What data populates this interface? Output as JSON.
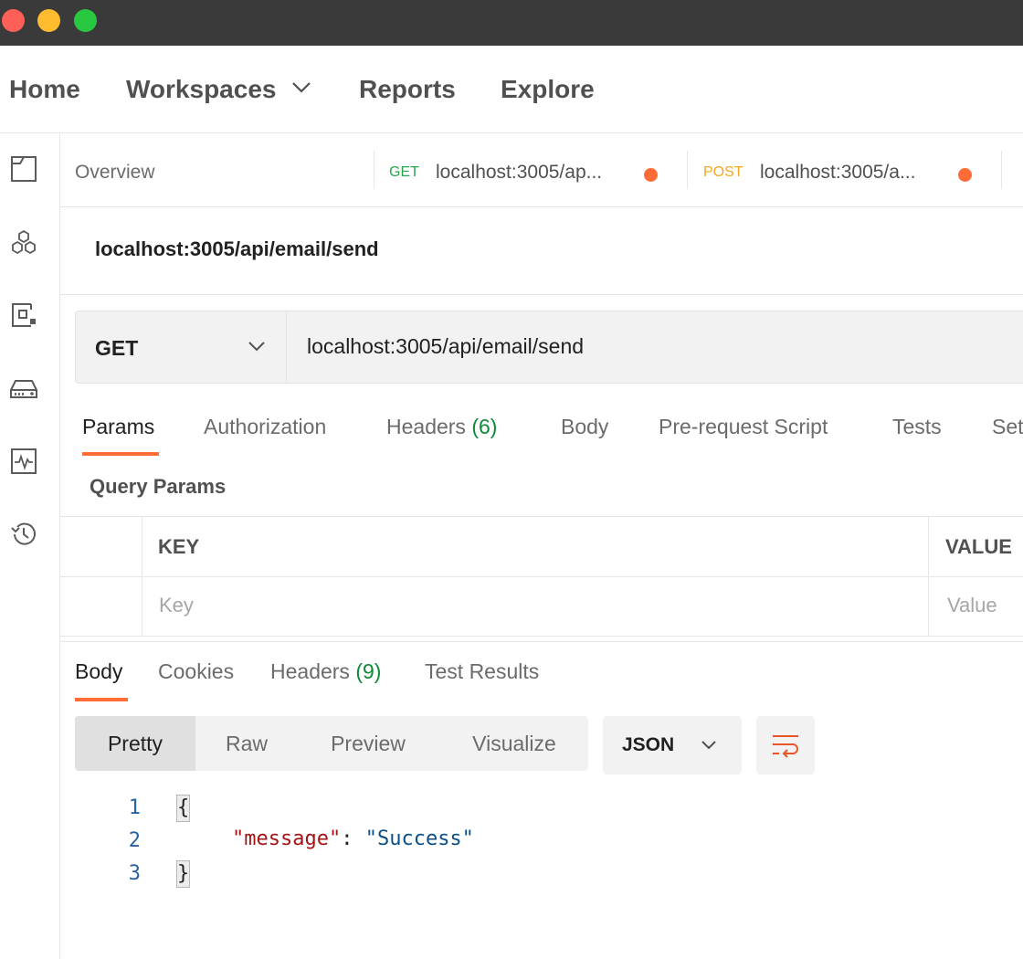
{
  "nav": {
    "home": "Home",
    "workspaces": "Workspaces",
    "reports": "Reports",
    "explore": "Explore"
  },
  "sidebar": {
    "icons": [
      "collections-icon",
      "apis-icon",
      "environments-icon",
      "mock-servers-icon",
      "monitors-icon",
      "history-icon"
    ]
  },
  "tabs": {
    "overview": "Overview",
    "items": [
      {
        "method": "GET",
        "url": "localhost:3005/ap...",
        "method_color": "#2aa44f"
      },
      {
        "method": "POST",
        "url": "localhost:3005/a...",
        "method_color": "#f5a623"
      }
    ],
    "unsaved_dot_color": "#ff6c37"
  },
  "request": {
    "title": "localhost:3005/api/email/send",
    "method": "GET",
    "url": "localhost:3005/api/email/send"
  },
  "request_tabs": {
    "params": "Params",
    "authorization": "Authorization",
    "headers": "Headers",
    "headers_count": "(6)",
    "body": "Body",
    "pre_request": "Pre-request Script",
    "tests": "Tests",
    "settings": "Set"
  },
  "query_params": {
    "label": "Query Params",
    "columns": {
      "key": "KEY",
      "value": "VALUE"
    },
    "placeholders": {
      "key": "Key",
      "value": "Value"
    }
  },
  "response_tabs": {
    "body": "Body",
    "cookies": "Cookies",
    "headers": "Headers",
    "headers_count": "(9)",
    "test_results": "Test Results"
  },
  "response_view": {
    "pretty": "Pretty",
    "raw": "Raw",
    "preview": "Preview",
    "visualize": "Visualize",
    "format": "JSON"
  },
  "response_body": {
    "line_numbers": [
      "1",
      "2",
      "3"
    ],
    "open_brace": "{",
    "key": "\"message\"",
    "colon": ": ",
    "value": "\"Success\"",
    "close_brace": "}"
  },
  "colors": {
    "accent": "#ff6c37",
    "get": "#2aa44f",
    "post": "#f5a623"
  }
}
